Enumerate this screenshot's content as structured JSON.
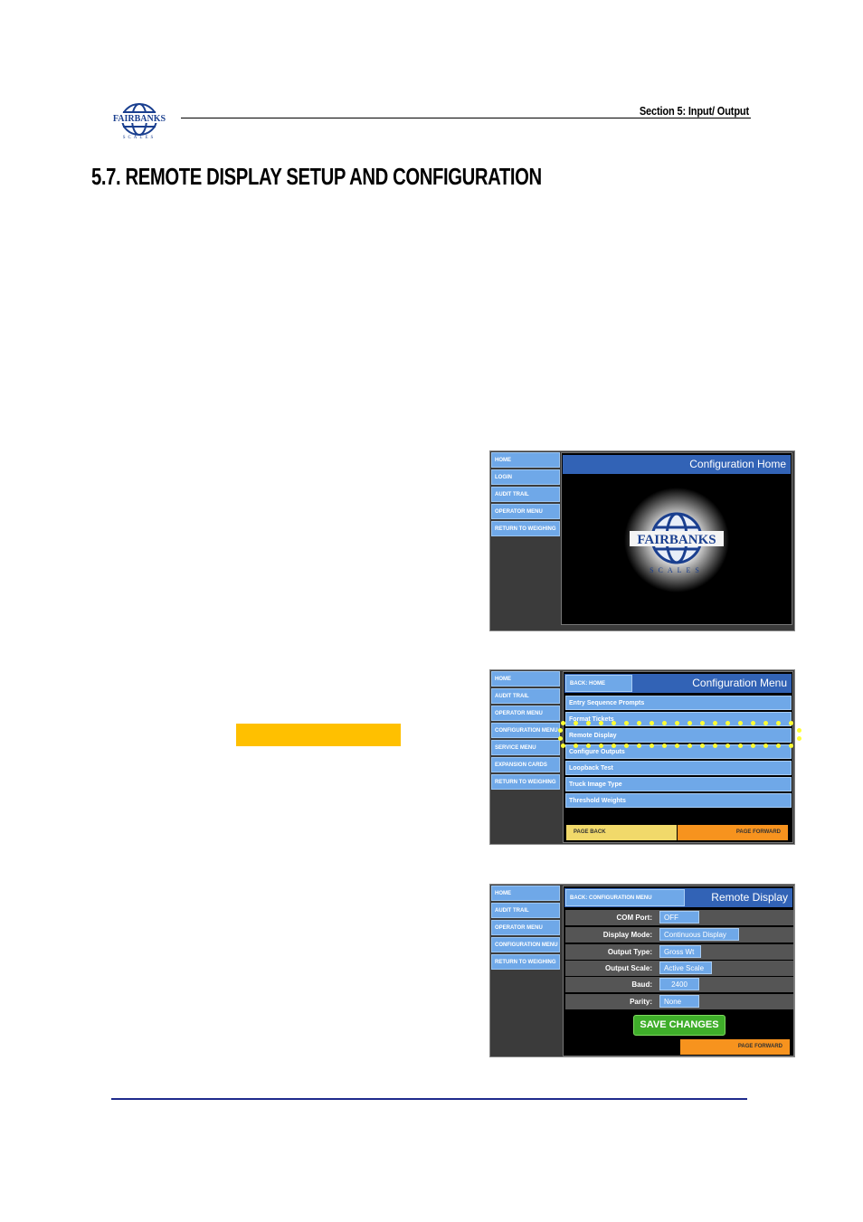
{
  "header": {
    "logo_text": "FAIRBANKS",
    "logo_sub": "SCALES",
    "section": "Section 5: Input/ Output"
  },
  "title": "5.7.  REMOTE DISPLAY SETUP AND CONFIGURATION",
  "screen1": {
    "nav": [
      "HOME",
      "LOGIN",
      "AUDIT TRAIL",
      "OPERATOR MENU",
      "RETURN TO WEIGHING"
    ],
    "title": "Configuration Home",
    "logo_text": "FAIRBANKS",
    "logo_sub": "SCALES"
  },
  "screen2": {
    "nav": [
      "HOME",
      "AUDIT TRAIL",
      "OPERATOR MENU",
      "CONFIGURATION MENU",
      "SERVICE MENU",
      "EXPANSION CARDS",
      "RETURN TO WEIGHING"
    ],
    "back": "BACK: HOME",
    "title": "Configuration Menu",
    "items": [
      "Entry Sequence Prompts",
      "Format Tickets",
      "Remote Display",
      "Configure Outputs",
      "Loopback Test",
      "Truck Image Type",
      "Threshold Weights"
    ],
    "page_back": "PAGE BACK",
    "page_forward": "PAGE FORWARD"
  },
  "screen3": {
    "nav": [
      "HOME",
      "AUDIT TRAIL",
      "OPERATOR MENU",
      "CONFIGURATION MENU",
      "RETURN TO WEIGHING"
    ],
    "back": "BACK: CONFIGURATION MENU",
    "title": "Remote Display",
    "fields": [
      {
        "label": "COM Port:",
        "value": "OFF"
      },
      {
        "label": "Display Mode:",
        "value": "Continuous Display"
      },
      {
        "label": "Output Type:",
        "value": "Gross Wt"
      },
      {
        "label": "Output Scale:",
        "value": "Active Scale"
      },
      {
        "label": "Baud:",
        "value": "2400"
      },
      {
        "label": "Parity:",
        "value": "None"
      }
    ],
    "save": "SAVE CHANGES",
    "page_forward": "PAGE FORWARD"
  },
  "colors": {
    "highlight": "#ffc000",
    "nav_blue": "#6fa8e8",
    "title_bar": "#3263b6",
    "save_green": "#3fae2a",
    "page_forward": "#f7931e",
    "page_back": "#f1d96a",
    "footer_rule": "#1f2a8c"
  }
}
